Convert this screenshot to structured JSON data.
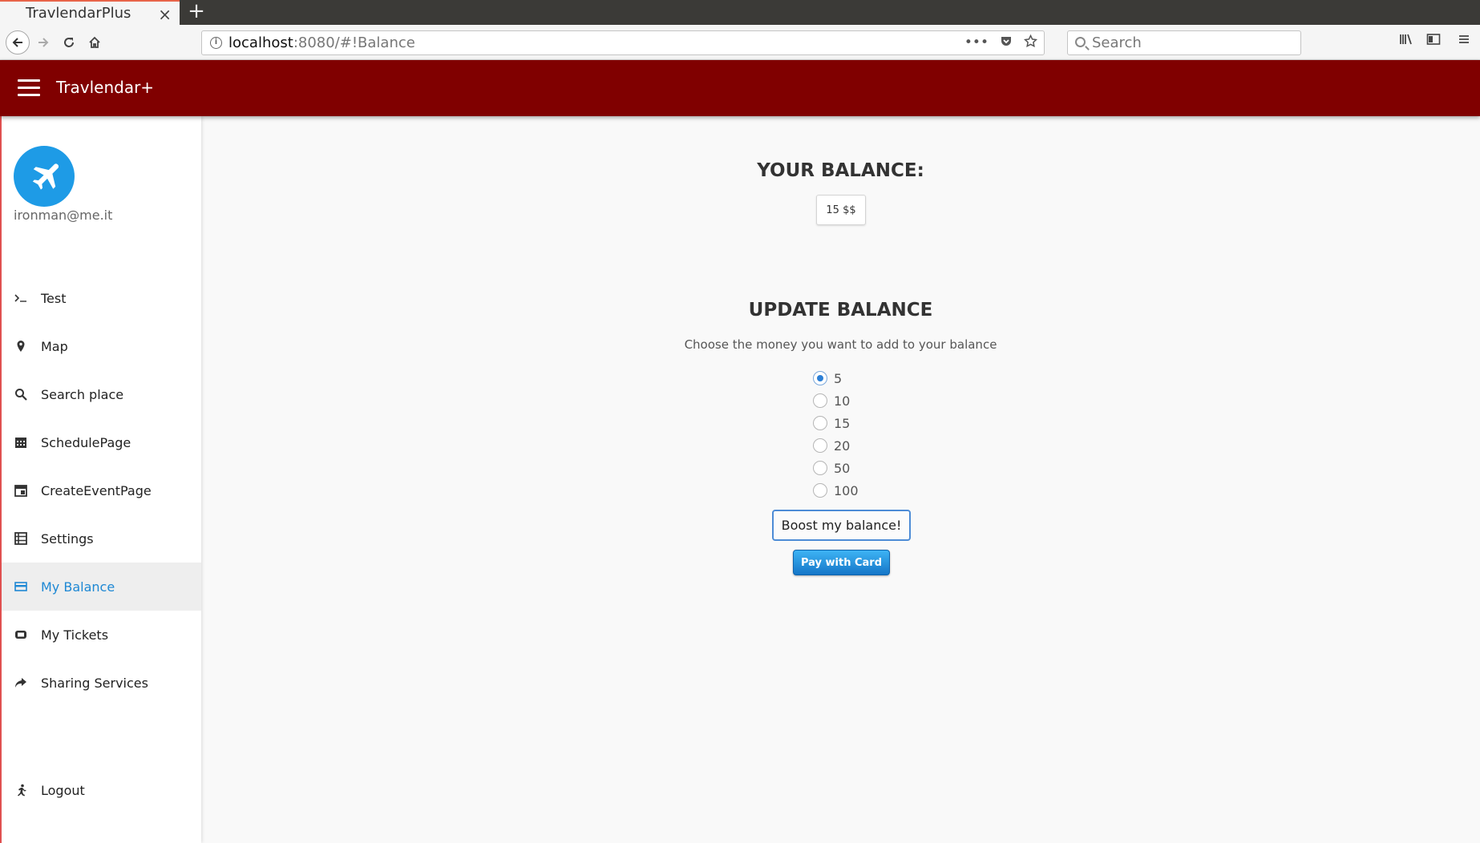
{
  "browser": {
    "tab_title": "TravlendarPlus",
    "tab_close": "×",
    "new_tab": "+",
    "url_host": "localhost",
    "url_path": ":8080/#!Balance",
    "search_placeholder": "Search"
  },
  "app": {
    "title": "Travlendar+",
    "user_email": "ironman@me.it",
    "accent_color": "#800000",
    "avatar_color": "#1e9be6"
  },
  "sidebar": {
    "items": [
      {
        "label": "Test",
        "icon": "terminal-icon"
      },
      {
        "label": "Map",
        "icon": "map-pin-icon"
      },
      {
        "label": "Search place",
        "icon": "search-icon"
      },
      {
        "label": "SchedulePage",
        "icon": "calendar-icon"
      },
      {
        "label": "CreateEventPage",
        "icon": "calendar-add-icon"
      },
      {
        "label": "Settings",
        "icon": "settings-list-icon"
      },
      {
        "label": "My Balance",
        "icon": "credit-card-icon",
        "active": true
      },
      {
        "label": "My Tickets",
        "icon": "ticket-icon"
      },
      {
        "label": "Sharing Services",
        "icon": "share-icon"
      }
    ],
    "logout_label": "Logout"
  },
  "balance": {
    "title": "YOUR BALANCE:",
    "value": "15 $$"
  },
  "update": {
    "title": "UPDATE BALANCE",
    "instructions": "Choose the money you want to add to your balance",
    "options": [
      "5",
      "10",
      "15",
      "20",
      "50",
      "100"
    ],
    "selected": "5",
    "boost_label": "Boost my balance!",
    "pay_label": "Pay with Card"
  }
}
